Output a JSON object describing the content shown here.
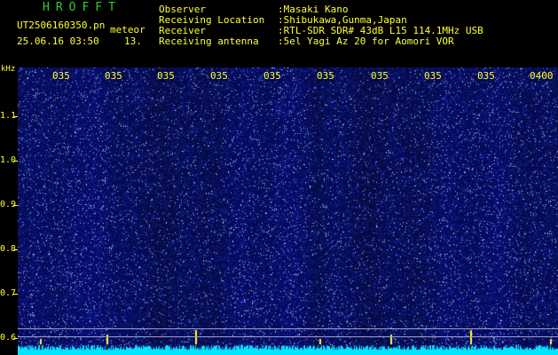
{
  "header": {
    "app_title": "HROFFT",
    "file_name": "UT2506160350.pn",
    "meteor_label": "meteor",
    "date_time": "25.06.16 03:50",
    "count": "13."
  },
  "info": [
    {
      "label": "Observer",
      "value": ":Masaki Kano"
    },
    {
      "label": "Receiving Location",
      "value": ":Shibukawa,Gunma,Japan"
    },
    {
      "label": "Receiver",
      "value": ":RTL-SDR SDR# 43dB L15 114.1MHz USB"
    },
    {
      "label": "Receiving antenna",
      "value": ":5el Yagi Az 20 for Aomori VOR"
    }
  ],
  "y_axis": {
    "unit": "kHz",
    "ticks": [
      "1.1",
      "1.0",
      "0.9",
      "0.8",
      "0.7",
      "0.6"
    ]
  },
  "x_axis": {
    "ticks": [
      "035",
      "035",
      "035",
      "035",
      "035",
      "035",
      "035",
      "035",
      "035",
      "0400"
    ]
  },
  "colors": {
    "background": "#000000",
    "spectrogram": "#0a1060",
    "text": "#ffff33",
    "title": "#33cc33",
    "baseline": "#00e5ff"
  }
}
